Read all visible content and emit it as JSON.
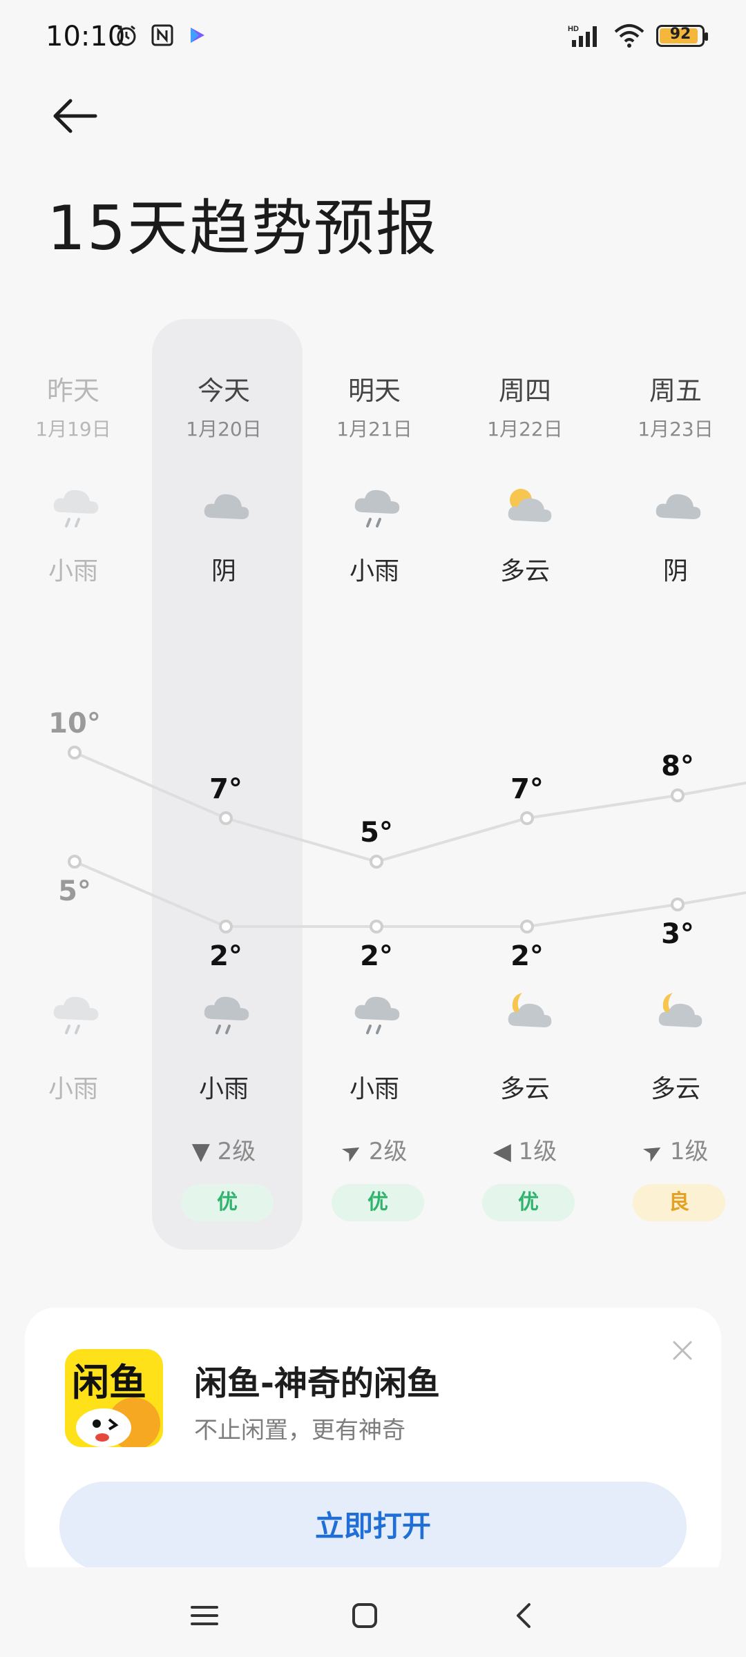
{
  "status": {
    "time": "10:10",
    "network": "HD",
    "battery": "92",
    "battery_fill": 0.92
  },
  "page": {
    "title": "15天趋势预报"
  },
  "days": [
    {
      "name": "昨天",
      "date": "1月19日",
      "day_weather": "小雨",
      "day_icon": "light-rain-icon",
      "high": "10°",
      "low": "5°",
      "night_icon": "light-rain-icon",
      "night_weather": "小雨",
      "wind": "",
      "aqi": "",
      "dim": true
    },
    {
      "name": "今天",
      "date": "1月20日",
      "day_weather": "阴",
      "day_icon": "overcast-icon",
      "high": "7°",
      "low": "2°",
      "night_icon": "light-rain-icon",
      "night_weather": "小雨",
      "wind": "2级",
      "wind_arrow": "▼",
      "aqi": "优",
      "aqi_level": "good"
    },
    {
      "name": "明天",
      "date": "1月21日",
      "day_weather": "小雨",
      "day_icon": "light-rain-icon",
      "high": "5°",
      "low": "2°",
      "night_icon": "light-rain-icon",
      "night_weather": "小雨",
      "wind": "2级",
      "wind_arrow": "➤",
      "aqi": "优",
      "aqi_level": "good"
    },
    {
      "name": "周四",
      "date": "1月22日",
      "day_weather": "多云",
      "day_icon": "partly-cloudy-icon",
      "high": "7°",
      "low": "2°",
      "night_icon": "partly-cloudy-night-icon",
      "night_weather": "多云",
      "wind": "1级",
      "wind_arrow": "◀",
      "aqi": "优",
      "aqi_level": "good"
    },
    {
      "name": "周五",
      "date": "1月23日",
      "day_weather": "阴",
      "day_icon": "overcast-icon",
      "high": "8°",
      "low": "3°",
      "night_icon": "partly-cloudy-night-icon",
      "night_weather": "多云",
      "wind": "1级",
      "wind_arrow": "➤",
      "aqi": "良",
      "aqi_level": "moderate"
    }
  ],
  "colors": {
    "aqi_good_bg": "#e4f6ec",
    "aqi_good_text": "#2fb36d",
    "aqi_moderate_bg": "#fdf1d3",
    "aqi_moderate_text": "#e3a226"
  },
  "ad": {
    "app_name": "闲鱼-神奇的闲鱼",
    "tagline": "不止闲置，更有神奇",
    "logo_text": "闲鱼",
    "cta": "立即打开"
  }
}
